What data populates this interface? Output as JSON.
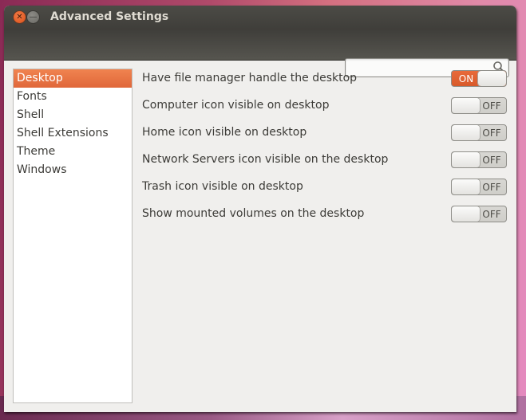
{
  "window": {
    "title": "Advanced Settings",
    "controls": [
      "close",
      "minimize"
    ]
  },
  "search": {
    "value": "",
    "placeholder": ""
  },
  "sidebar": {
    "items": [
      {
        "label": "Desktop",
        "selected": true
      },
      {
        "label": "Fonts",
        "selected": false
      },
      {
        "label": "Shell",
        "selected": false
      },
      {
        "label": "Shell Extensions",
        "selected": false
      },
      {
        "label": "Theme",
        "selected": false
      },
      {
        "label": "Windows",
        "selected": false
      }
    ]
  },
  "settings": [
    {
      "label": "Have file manager handle the desktop",
      "state": "ON"
    },
    {
      "label": "Computer icon visible on desktop",
      "state": "OFF"
    },
    {
      "label": "Home icon visible on desktop",
      "state": "OFF"
    },
    {
      "label": "Network Servers icon visible on the desktop",
      "state": "OFF"
    },
    {
      "label": "Trash icon visible on desktop",
      "state": "OFF"
    },
    {
      "label": "Show mounted volumes on the desktop",
      "state": "OFF"
    }
  ],
  "colors": {
    "accent": "#e56a37",
    "titlebar": "#3f3e3a",
    "background": "#f0efed"
  }
}
